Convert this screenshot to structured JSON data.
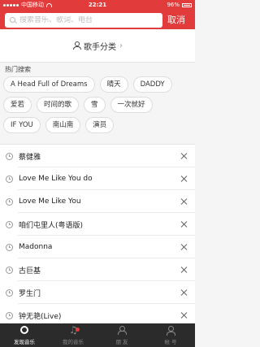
{
  "status_bar": {
    "carrier": "中国移动",
    "time": "22:21",
    "battery_percent": "96%"
  },
  "search": {
    "placeholder": "搜索音乐、歌词、电台",
    "cancel_label": "取消"
  },
  "category": {
    "label": "歌手分类",
    "chevron": "›"
  },
  "hot_search": {
    "title": "热门搜索",
    "rows": [
      [
        "A Head Full of Dreams",
        "晴天",
        "DADDY"
      ],
      [
        "爱若",
        "时间的歌",
        "雪",
        "一次就好"
      ],
      [
        "IF YOU",
        "南山南",
        "演员"
      ]
    ]
  },
  "history": [
    "蔡健雅",
    "Love Me Like You do",
    "Love Me Like You",
    "咱们屯里人(粤语版)",
    "Madonna",
    "古巨基",
    "罗生门",
    "钟无艳(Live)"
  ],
  "tabbar": [
    {
      "label": "发现音乐",
      "icon": "discover-icon",
      "active": true
    },
    {
      "label": "我的音乐",
      "icon": "music-note-icon",
      "active": false
    },
    {
      "label": "朋 友",
      "icon": "friends-icon",
      "active": false
    },
    {
      "label": "帐 号",
      "icon": "account-icon",
      "active": false
    }
  ],
  "colors": {
    "brand_red": "#e23b3b",
    "tabbar_bg": "#2b2b2b"
  }
}
